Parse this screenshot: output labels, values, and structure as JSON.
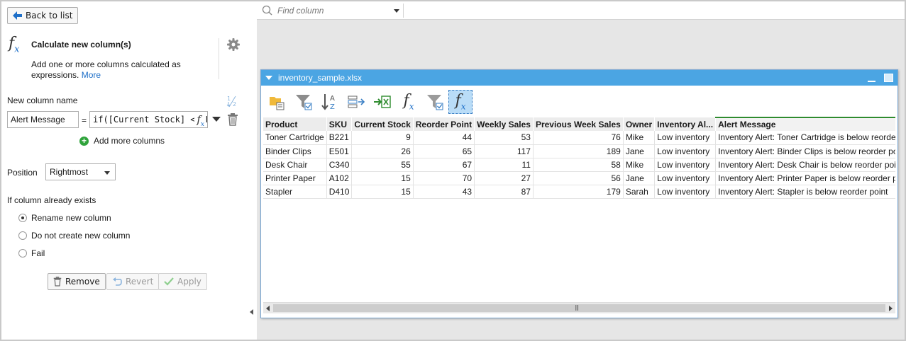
{
  "left_panel": {
    "back_label": "Back to list",
    "title": "Calculate new column(s)",
    "description": "Add one or more columns calculated as expressions.",
    "more_link": "More",
    "new_column_label": "New column name",
    "column_name_value": "Alert Message",
    "equals": "=",
    "expression_value": "if([Current Stock] < [Reorder Point], \"Inventory Alert: \" + [Product] + \" is below reorder point\", \"\")",
    "add_more_label": "Add more columns",
    "position_label": "Position",
    "position_value": "Rightmost",
    "exists_label": "If column already exists",
    "options": [
      {
        "label": "Rename new column",
        "selected": true
      },
      {
        "label": "Do not create new column",
        "selected": false
      },
      {
        "label": "Fail",
        "selected": false
      }
    ],
    "remove_label": "Remove",
    "revert_label": "Revert",
    "apply_label": "Apply"
  },
  "workspace": {
    "find_placeholder": "Find column",
    "window_title": "inventory_sample.xlsx",
    "table": {
      "headers": [
        "Product",
        "SKU",
        "Current Stock",
        "Reorder Point",
        "Weekly Sales",
        "Previous Week Sales",
        "Owner",
        "Inventory Al...",
        "Alert Message"
      ],
      "rows": [
        [
          "Toner Cartridge",
          "B221",
          "9",
          "44",
          "53",
          "76",
          "Mike",
          "Low inventory",
          "Inventory Alert: Toner Cartridge is below reorder point"
        ],
        [
          "Binder Clips",
          "E501",
          "26",
          "65",
          "117",
          "189",
          "Jane",
          "Low inventory",
          "Inventory Alert: Binder Clips is below reorder point"
        ],
        [
          "Desk Chair",
          "C340",
          "55",
          "67",
          "11",
          "58",
          "Mike",
          "Low inventory",
          "Inventory Alert: Desk Chair is below reorder point"
        ],
        [
          "Printer Paper",
          "A102",
          "15",
          "70",
          "27",
          "56",
          "Jane",
          "Low inventory",
          "Inventory Alert: Printer Paper is below reorder point"
        ],
        [
          "Stapler",
          "D410",
          "15",
          "43",
          "87",
          "179",
          "Sarah",
          "Low inventory",
          "Inventory Alert: Stapler is below reorder point"
        ]
      ]
    }
  },
  "colors": {
    "accent_blue": "#4ba5e3",
    "selected_column": "#2e8b2e",
    "add_green": "#2fa33b"
  }
}
